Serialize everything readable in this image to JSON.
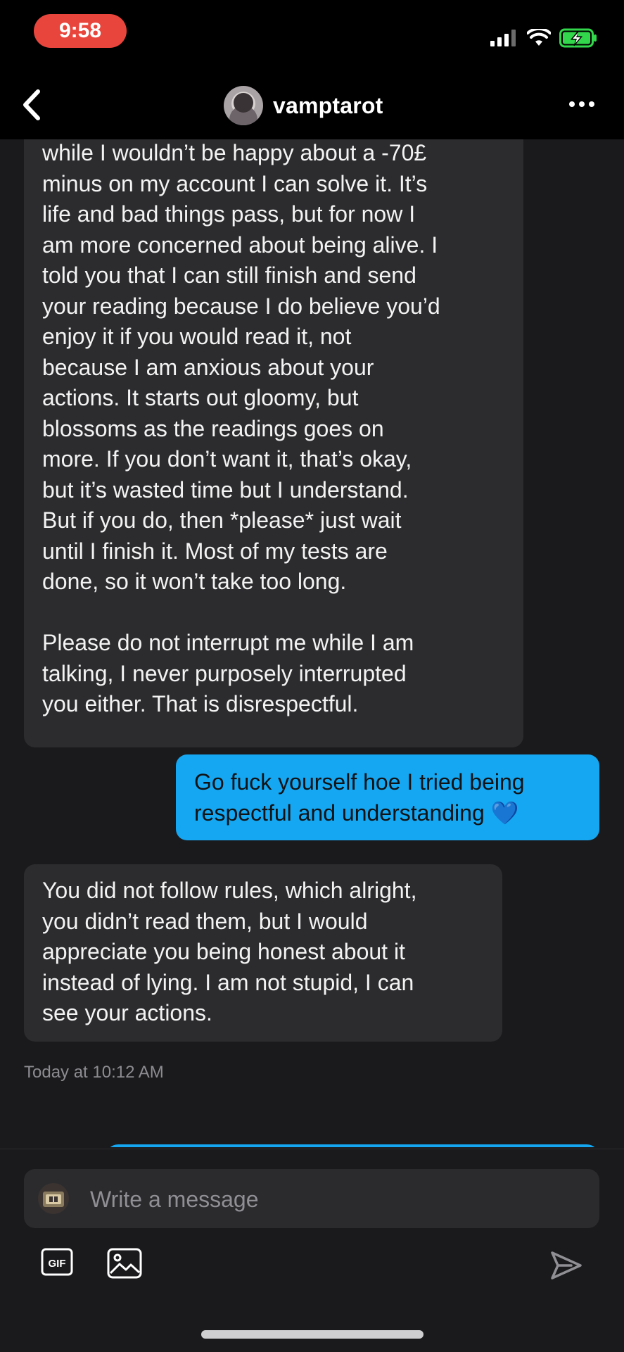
{
  "status_bar": {
    "time": "9:58"
  },
  "header": {
    "contact_name": "vamptarot"
  },
  "messages": [
    {
      "direction": "in",
      "text": "while I wouldn’t be happy about a -70£\nminus on my account I can solve it. It’s\nlife and bad things pass, but for now I\nam more concerned about being alive. I\ntold you that I can still finish and send\nyour reading because I do believe you’d\nenjoy it if you would read it, not\nbecause I am anxious about your\nactions. It starts out gloomy, but\nblossoms as the readings goes on\nmore. If you don’t want it, that’s okay,\nbut it’s wasted time but I understand.\nBut if you do, then *please* just wait\nuntil I finish it. Most of my tests are\ndone, so it won’t take too long."
    },
    {
      "direction": "in",
      "text": "Please do not interrupt me while I am\ntalking, I never purposely interrupted\nyou either. That is disrespectful."
    },
    {
      "direction": "out",
      "text": "Go fuck yourself hoe I tried being\nrespectful and understanding 💙"
    },
    {
      "direction": "in",
      "text": "You did not follow rules, which alright,\nyou didn’t read them, but I would\nappreciate you being honest about it\ninstead of lying. I am not stupid, I can\nsee your actions."
    }
  ],
  "timestamp": "Today at 10:12 AM",
  "composer": {
    "placeholder": "Write a message",
    "gif_label": "GIF"
  },
  "icons": {
    "back": "chevron-left-icon",
    "more": "ellipsis-icon",
    "gif": "gif-icon",
    "image": "image-icon",
    "send": "send-icon"
  },
  "colors": {
    "background": "#1a1a1c",
    "incoming_bubble": "#2c2c2f",
    "outgoing_bubble": "#16a7f2",
    "time_pill": "#e8453c"
  }
}
